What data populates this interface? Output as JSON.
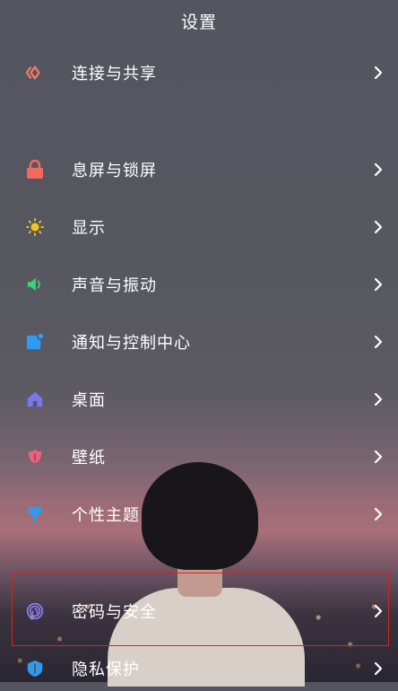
{
  "header": {
    "title": "设置"
  },
  "menu": {
    "items": [
      {
        "label": "连接与共享",
        "icon": "connection-share-icon",
        "color": "#f07a63"
      },
      {
        "label": "息屏与锁屏",
        "icon": "lock-icon",
        "color": "#f26a5b"
      },
      {
        "label": "显示",
        "icon": "sun-icon",
        "color": "#f5c518"
      },
      {
        "label": "声音与振动",
        "icon": "speaker-icon",
        "color": "#3ecf7a"
      },
      {
        "label": "通知与控制中心",
        "icon": "notification-icon",
        "color": "#2f9bf0"
      },
      {
        "label": "桌面",
        "icon": "home-icon",
        "color": "#7a76f0"
      },
      {
        "label": "壁纸",
        "icon": "tulip-icon",
        "color": "#f0607a"
      },
      {
        "label": "个性主题",
        "icon": "brush-icon",
        "color": "#2f9bf0"
      },
      {
        "label": "密码与安全",
        "icon": "fingerprint-icon",
        "color": "#8a80f5"
      },
      {
        "label": "隐私保护",
        "icon": "privacy-shield-icon",
        "color": "#2f9bf0"
      }
    ]
  },
  "highlight_color": "#d9241c"
}
